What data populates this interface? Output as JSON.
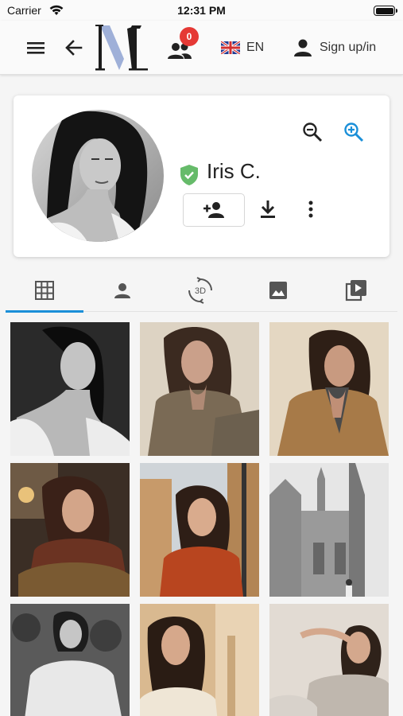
{
  "status_bar": {
    "carrier": "Carrier",
    "time": "12:31 PM"
  },
  "app_bar": {
    "logo_letter": "M",
    "notification_count": "0",
    "language": "EN",
    "sign_label": "Sign up/in",
    "colors": {
      "badge": "#e53935",
      "logo_accent": "#9fb0d8"
    }
  },
  "profile": {
    "name": "Iris C.",
    "verified": true,
    "verified_color": "#66bb6a"
  },
  "tabs": [
    {
      "icon": "grid-icon",
      "active": true
    },
    {
      "icon": "person-icon",
      "active": false
    },
    {
      "icon": "3d-rotate-icon",
      "label": "3D",
      "active": false
    },
    {
      "icon": "image-icon",
      "active": false
    },
    {
      "icon": "video-library-icon",
      "active": false
    }
  ],
  "accent_color": "#1a8fd8",
  "gallery": [
    {
      "tone": "bw"
    },
    {
      "tone": "warm-olive"
    },
    {
      "tone": "camel"
    },
    {
      "tone": "cafe"
    },
    {
      "tone": "street-rust"
    },
    {
      "tone": "cathedral-bw"
    },
    {
      "tone": "garden-bw"
    },
    {
      "tone": "arcade"
    },
    {
      "tone": "studio-grey"
    }
  ]
}
